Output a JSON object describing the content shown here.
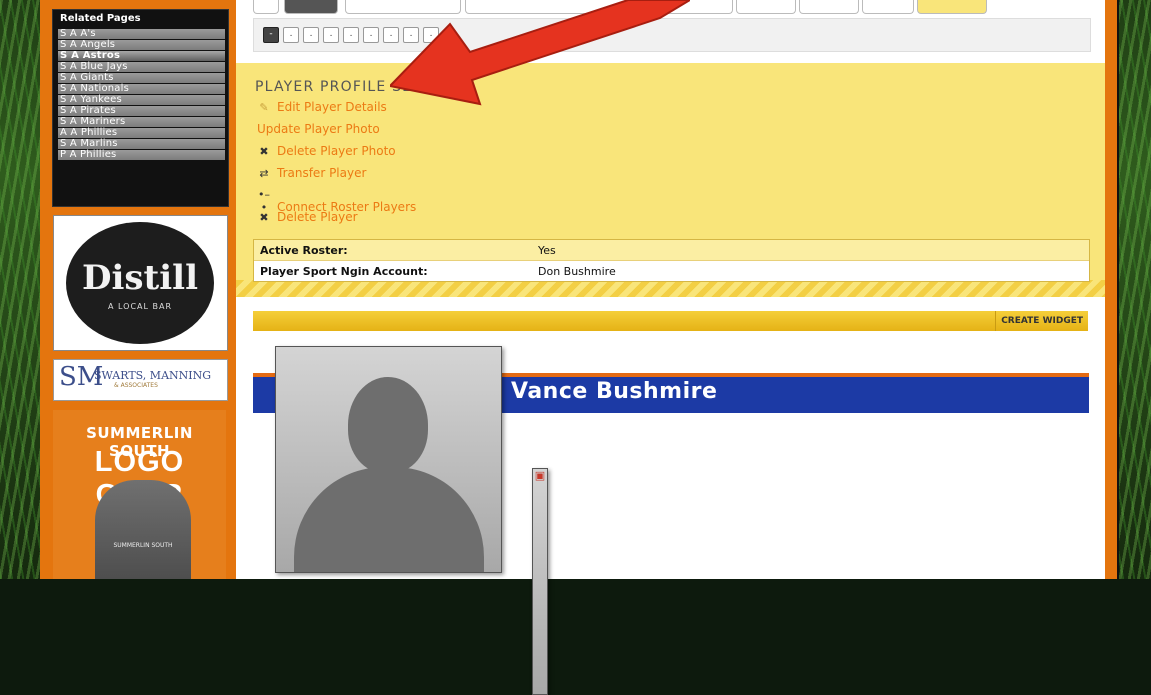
{
  "related_pages": {
    "title": "Related Pages",
    "items": [
      "S A A's",
      "S A Angels",
      "S A Astros",
      "S A Blue Jays",
      "S A Giants",
      "S A Nationals",
      "S A Yankees",
      "S A Pirates",
      "S A Mariners",
      "A A Phillies",
      "S A Marlins",
      "P A Phillies"
    ],
    "active_index": 2
  },
  "ads": {
    "distill": {
      "word": "Distill",
      "sub": "A LOCAL BAR"
    },
    "swarts": {
      "monogram": "SM",
      "name": "SWARTS, MANNING",
      "sub": "& ASSOCIATES"
    },
    "summerlin": {
      "title": "SUMMERLIN SOUTH",
      "gear": "LOGO GEAR",
      "hoodie_text": "SUMMERLIN SOUTH"
    }
  },
  "pager": {
    "pages": [
      "-",
      ".",
      ".",
      ".",
      ".",
      ".",
      ".",
      ".",
      "."
    ],
    "current_index": 0
  },
  "profile_settings": {
    "title": "PLAYER PROFILE SETTINGS",
    "actions": [
      {
        "label": "Edit Player Details",
        "icon": "pencil-icon",
        "glyph": "✎"
      },
      {
        "label": "Update Player Photo",
        "icon": "photo-icon",
        "glyph": "▣"
      },
      {
        "label": "Delete Player Photo",
        "icon": "x-icon",
        "glyph": "✖"
      },
      {
        "label": "Transfer Player",
        "icon": "transfer-icon",
        "glyph": "⇄"
      },
      {
        "label": "Connect Roster Players",
        "icon": "connect-icon",
        "glyph": "•–•"
      },
      {
        "label": "Delete Player",
        "icon": "x-icon",
        "glyph": "✖"
      }
    ]
  },
  "info": {
    "rows": [
      {
        "label": "Active Roster:",
        "value": "Yes"
      },
      {
        "label": "Player Sport Ngin Account:",
        "value": "Don Bushmire"
      }
    ]
  },
  "widget": {
    "create_label": "CREATE WIDGET"
  },
  "player": {
    "name": "Vance Bushmire"
  },
  "colors": {
    "accent_orange": "#e4750e",
    "panel_yellow": "#f9e57a",
    "banner_blue": "#1c3aa5",
    "arrow_red": "#e5331f"
  }
}
